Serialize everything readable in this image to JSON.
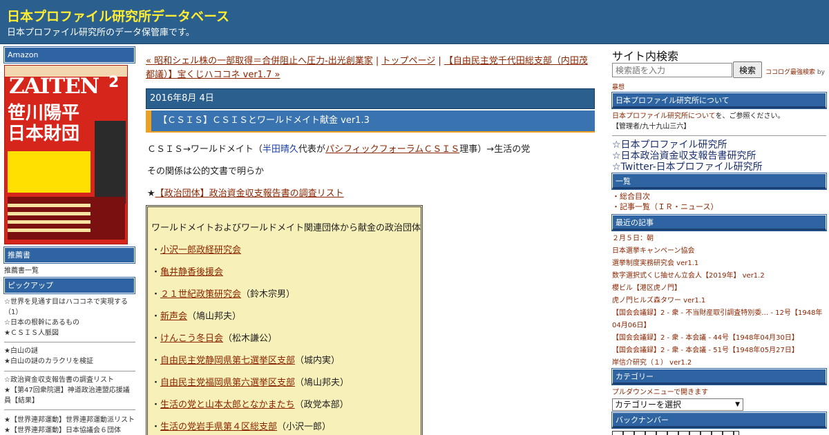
{
  "header": {
    "site_title": "日本プロファイル研究所データベース",
    "site_description": "日本プロファイル研究所のデータ保管庫です。"
  },
  "left": {
    "amazon_heading": "Amazon",
    "cover": {
      "logo": "ZAITEN",
      "issue": "2",
      "headline_1": "笹川陽平",
      "headline_2": "日本財団"
    },
    "recommended_heading": "推薦書",
    "recommended_link": "推薦書一覧",
    "pickup_heading": "ピックアップ",
    "pickup_groups": [
      [
        "☆世界を見通す目はハココネで実現する（1）",
        "☆日本の根幹にあるもの",
        "★ＣＳＩＳ人脈図"
      ],
      [
        "★白山の謎",
        "★白山の謎のカラクリを検証"
      ],
      [
        "☆政治資金収支報告書の調査リスト",
        "★【第47回衆院選】神道政治連盟応援議員【結果】"
      ],
      [
        "★【世界連邦運動】世界連邦運動派リスト",
        "★【世界連邦運動】日本協議会６団体"
      ]
    ]
  },
  "main": {
    "prev_link": "« 昭和シェル株の一部取得＝合併阻止へ圧力-出光創業家",
    "top_link": "トップページ",
    "next_link": "【自由民主党千代田総支部（内田茂都議）】宝くじハココネ ver1.7 »",
    "separator": "|",
    "date": "2016年8月 4日",
    "title": "【ＣＳＩＳ】ＣＳＩＳとワールドメイト献金 ver1.3",
    "para1": {
      "before": "ＣＳＩＳ→ワールドメイト（",
      "name": "半田晴久",
      "mid": "代表が",
      "link": "パシフィックフォーラムＣＳＩＳ",
      "after": "理事）→生活の党"
    },
    "para2": "その関係は公的文書で明らか",
    "para3": {
      "star": "★",
      "link": "【政治団体】政治資金収支報告書の調査リスト"
    },
    "box": {
      "heading": "ワールドメイトおよびワールドメイト関連団体から献金の政治団体",
      "items": [
        {
          "name": "小沢一郎政経研究会",
          "note": ""
        },
        {
          "name": "亀井静香後援会",
          "note": ""
        },
        {
          "name": "２１世紀政策研究会",
          "note": "（鈴木宗男）"
        },
        {
          "name": "新声会",
          "note": "（鳩山邦夫）"
        },
        {
          "name": "けんこう冬日会",
          "note": "（松木謙公）"
        },
        {
          "name": "自由民主党静岡県第七選挙区支部",
          "note": "（城内実）"
        },
        {
          "name": "自由民主党福岡県第六選挙区支部",
          "note": "（鳩山邦夫）"
        },
        {
          "name": "生活の党と山本太郎となかまたち",
          "note": "（政党本部）"
        },
        {
          "name": "生活の党岩手県第４区総支部",
          "note": "（小沢一郎）"
        }
      ]
    }
  },
  "right": {
    "search_title": "サイト内検索",
    "search_placeholder": "検索語を入力",
    "search_button": "検索",
    "search_note_link": "ココログ最強検索",
    "search_note_by": "by",
    "search_note_author": "暴想",
    "about_heading": "日本プロファイル研究所について",
    "about_link": "日本プロファイル研究所について",
    "about_text": "を、ご参照ください。",
    "admin_text": "【管理者/九十九山三六】",
    "big_links": [
      "☆日本プロファイル研究所",
      "☆日本政治資金収支報告書研究所",
      "☆Twitter-日本プロファイル研究所"
    ],
    "list_heading": "一覧",
    "list_items": [
      "・総合目次",
      "・記事一覧（ＩＲ・ニュース）"
    ],
    "recent_heading": "最近の記事",
    "recent_items": [
      "２月５日：朝",
      "日本選挙キャンペーン協会",
      "選挙制度実務研究会 ver1.1",
      "数字選択式くじ抽せん立会人【2019年】 ver1.2",
      "櫻ビル【港区虎ノ門】",
      "虎ノ門ヒルズ森タワー ver1.1",
      "【国会会議録】2 - 衆 - 不当財産取引調査特別委… - 12号【1948年04月06日】",
      "【国会会議録】2 - 衆 - 本会議 - 44号【1948年04月30日】",
      "【国会会議録】2 - 衆 - 本会議 - 51号【1948年05月27日】",
      "岸信介研究（１） ver1.2"
    ],
    "category_heading": "カテゴリー",
    "category_note": "プルダウンメニューで開きます",
    "category_select": "カテゴリーを選択",
    "backnumber_heading": "バックナンバー"
  }
}
